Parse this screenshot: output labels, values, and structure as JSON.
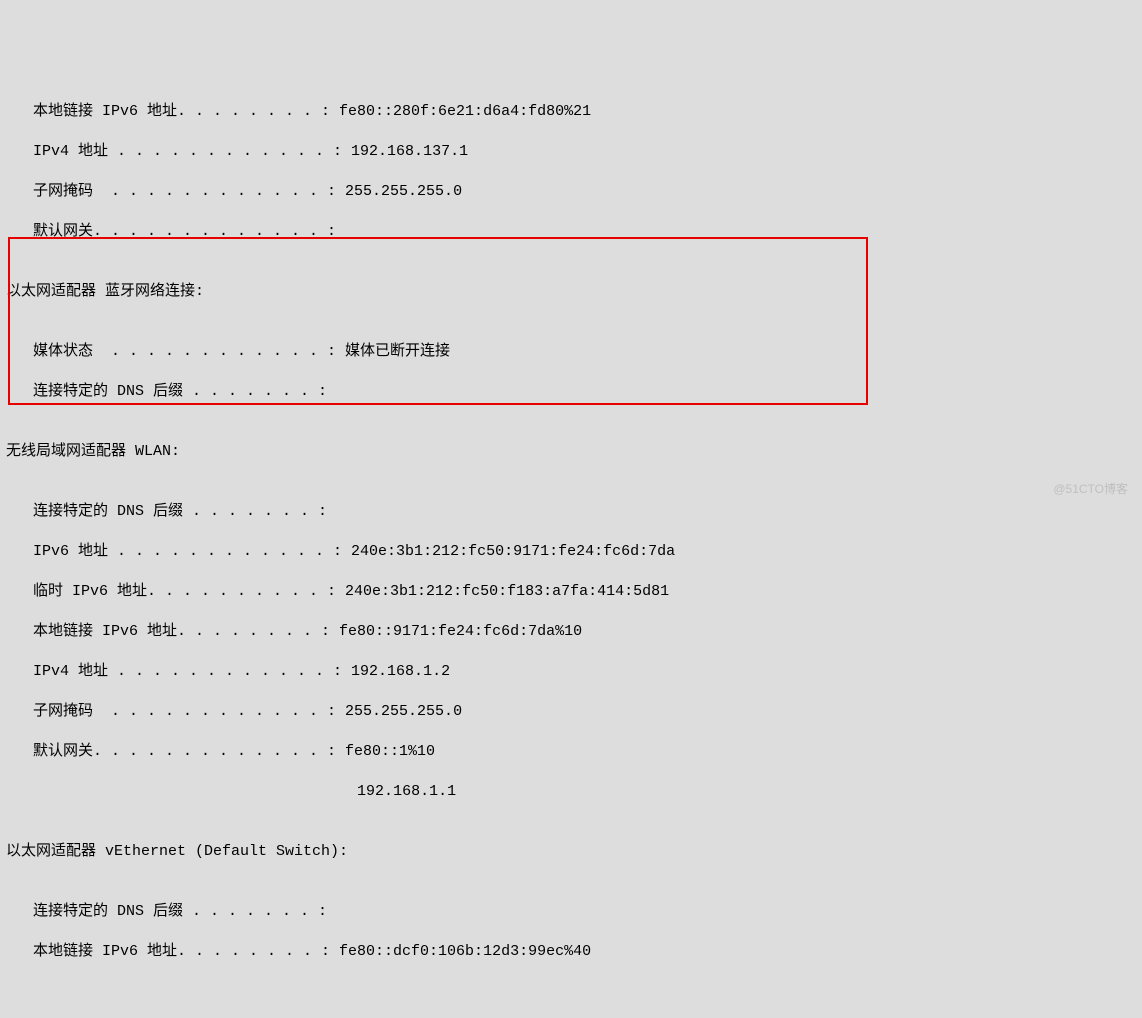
{
  "lines": {
    "l01": "   本地链接 IPv6 地址. . . . . . . . : fe80::280f:6e21:d6a4:fd80%21",
    "l02": "   IPv4 地址 . . . . . . . . . . . . : 192.168.137.1",
    "l03": "   子网掩码  . . . . . . . . . . . . : 255.255.255.0",
    "l04": "   默认网关. . . . . . . . . . . . . :",
    "l05": "",
    "l06": "以太网适配器 蓝牙网络连接:",
    "l07": "",
    "l08": "   媒体状态  . . . . . . . . . . . . : 媒体已断开连接",
    "l09": "   连接特定的 DNS 后缀 . . . . . . . :",
    "l10": "",
    "l11": "无线局域网适配器 WLAN:",
    "l12": "",
    "l13": "   连接特定的 DNS 后缀 . . . . . . . :",
    "l14": "   IPv6 地址 . . . . . . . . . . . . : 240e:3b1:212:fc50:9171:fe24:fc6d:7da",
    "l15": "   临时 IPv6 地址. . . . . . . . . . : 240e:3b1:212:fc50:f183:a7fa:414:5d81",
    "l16": "   本地链接 IPv6 地址. . . . . . . . : fe80::9171:fe24:fc6d:7da%10",
    "l17": "   IPv4 地址 . . . . . . . . . . . . : 192.168.1.2",
    "l18": "   子网掩码  . . . . . . . . . . . . : 255.255.255.0",
    "l19": "   默认网关. . . . . . . . . . . . . : fe80::1%10",
    "l20": "                                       192.168.1.1",
    "l21": "",
    "l22": "以太网适配器 vEthernet (Default Switch):",
    "l23": "",
    "l24": "   连接特定的 DNS 后缀 . . . . . . . :",
    "l25": "   本地链接 IPv6 地址. . . . . . . . : fe80::dcf0:106b:12d3:99ec%40"
  },
  "watermark": "@51CTO博客"
}
